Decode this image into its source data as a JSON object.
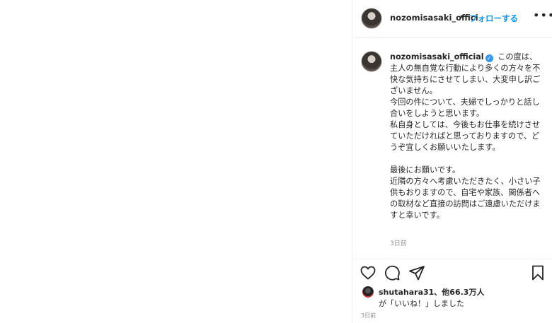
{
  "header": {
    "username": "nozomisasaki_offici",
    "separator": "•",
    "follow_label": "フォローする",
    "more_icon": "more-horizontal-icon"
  },
  "caption": {
    "username": "nozomisasaki_official",
    "verified_icon": "verified-badge-icon",
    "text": " この度は、主人の無自覚な行動により多くの方々を不快な気持ちにさせてしまい、大変申し訳ございません。\n今回の件について、夫婦でしっかりと話し合いをしようと思います。\n私自身としては、今後もお仕事を続けさせていただければと思っておりますので、どうぞ宜しくお願いいたします。\n\n最後にお願いです。\n近隣の方々へ考慮いただきたく、小さい子供もおりますので、自宅や家族、関係者への取材など直接の訪問はご遠慮いただけますと幸いです。",
    "time": "3日前"
  },
  "actions": {
    "like_icon": "heart-icon",
    "comment_icon": "comment-icon",
    "share_icon": "share-icon",
    "save_icon": "bookmark-icon"
  },
  "likes": {
    "line1": "shutahara31、他66.3万人",
    "line2": "が「いいね！」しました"
  },
  "post_time": "3日前",
  "colors": {
    "accent": "#0095f6",
    "verified": "#3897f0",
    "muted": "#8e8e8e",
    "divider": "#efefef"
  }
}
